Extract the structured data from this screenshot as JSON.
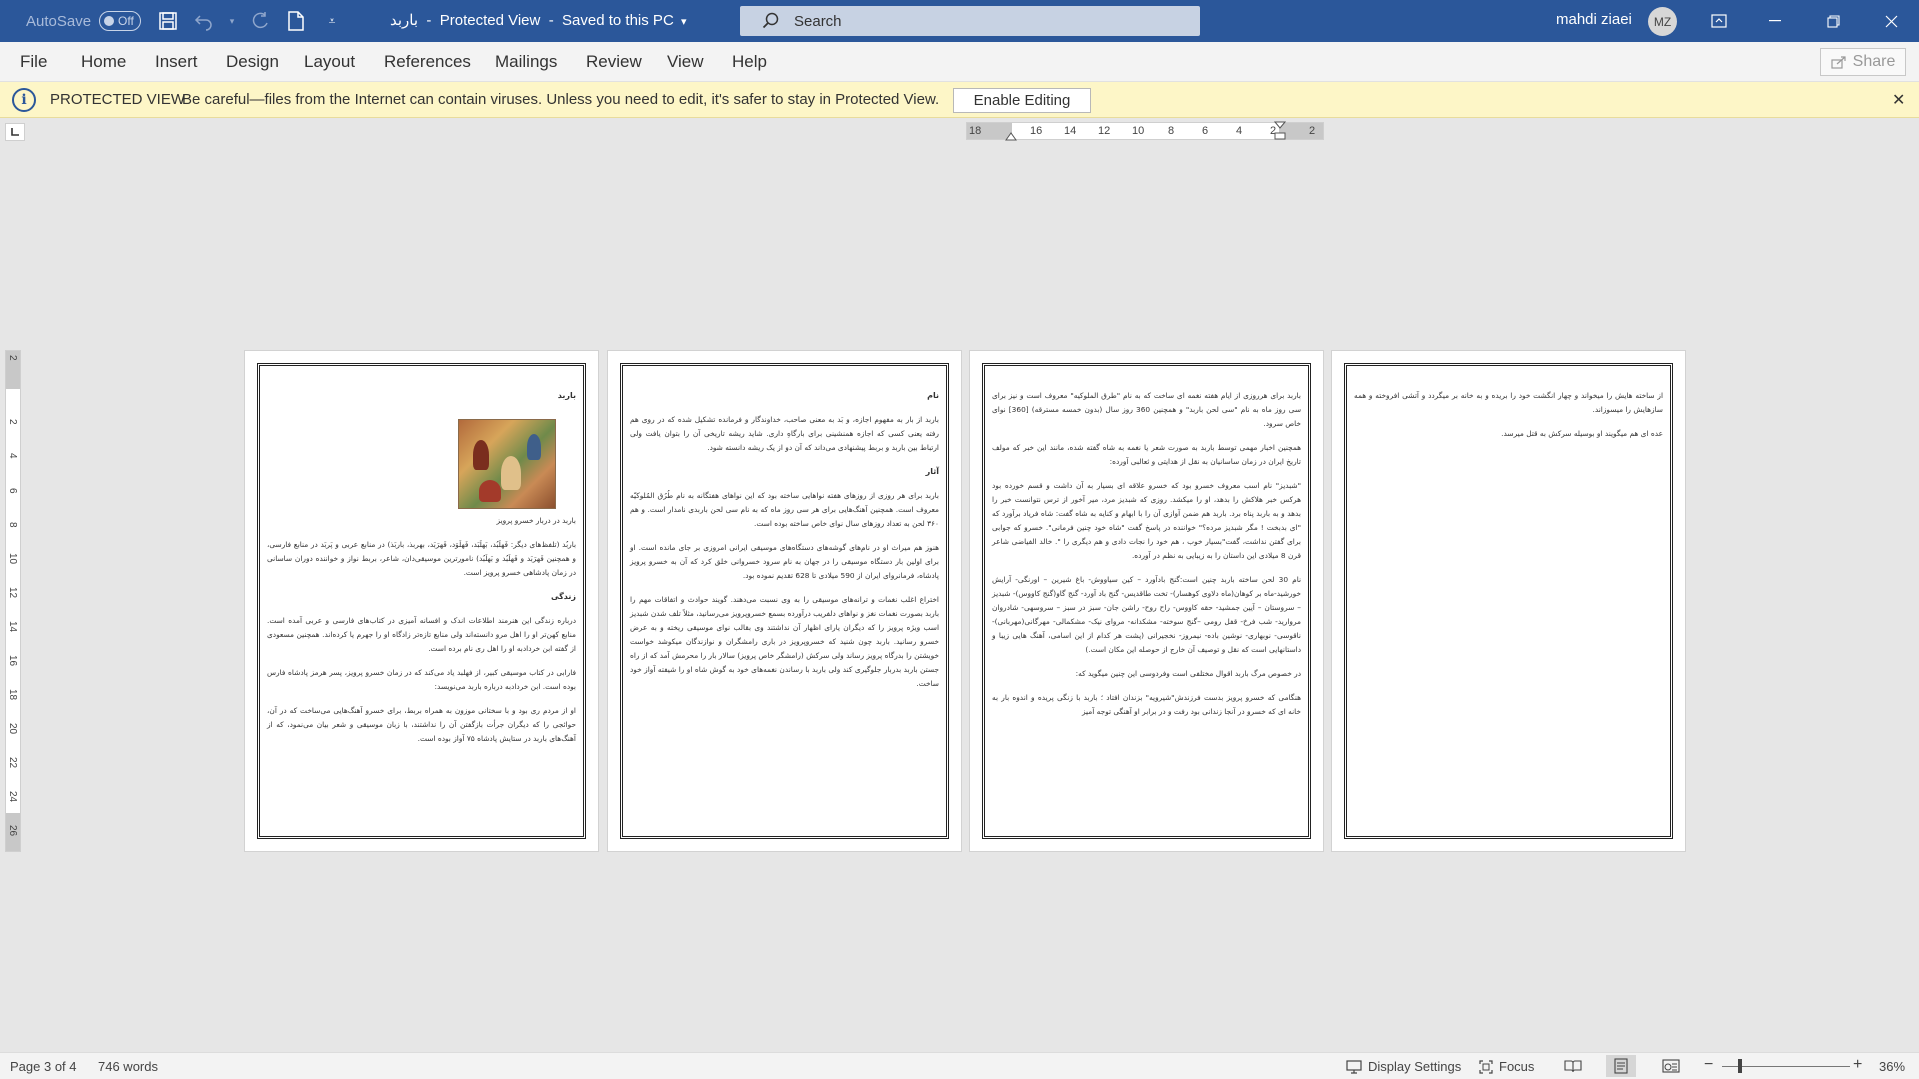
{
  "titlebar": {
    "autosave_label": "AutoSave",
    "autosave_state": "Off",
    "doc_name": "باربد",
    "separator1": "-",
    "view_mode": "Protected View",
    "separator2": "-",
    "save_status": "Saved to this PC",
    "search_placeholder": "Search",
    "user_name": "mahdi ziaei",
    "user_initials": "MZ",
    "accent_color": "#2b579a"
  },
  "menu": {
    "items": [
      "File",
      "Home",
      "Insert",
      "Design",
      "Layout",
      "References",
      "Mailings",
      "Review",
      "View",
      "Help"
    ],
    "share_label": "Share"
  },
  "protected": {
    "label": "PROTECTED VIEW",
    "message": "Be careful—files from the Internet can contain viruses. Unless you need to edit, it's safer to stay in Protected View.",
    "enable_label": "Enable Editing",
    "bar_color": "#fdf6c7"
  },
  "ruler": {
    "horizontal": [
      "18",
      "16",
      "14",
      "12",
      "10",
      "8",
      "6",
      "4",
      "2",
      "2"
    ],
    "vertical": [
      "2",
      "2",
      "4",
      "6",
      "8",
      "10",
      "12",
      "14",
      "16",
      "18",
      "20",
      "22",
      "24",
      "26"
    ]
  },
  "pages": {
    "p1": {
      "title": "باربد",
      "caption": "باربد در دربار خسرو پرویز",
      "para1": "باربُد (تلفظ‌های دیگر: فَهلَبُد، بَهلَبَد، فَهلَوَد، فَهرَبَد، بهربذ، باربَذ) در منابع عربی و پَربَد در منابع فارسی، و همچنین فَهرَبَد و فَهلَبُد و بَهلَبُد) نامورترین موسیقی‌دان، شاعر، بربط نواز و خواننده دوران ساسانی در زمان پادشاهی خسرو پرویز است.",
      "head2": "زندگی",
      "para2": "درباره زندگی این هنرمند اطلاعات اندک و افسانه آمیزی در کتاب‌های فارسی و عربی آمده است. منابع کهن‌تر او را اهل مرو دانسته‌اند ولی منابع تازه‌تر زادگاه او را جهرم یا کرد‌ه‌اند. همچنین مسعودی از گفته ابن خردادبه او را اهل ری نام برده است.",
      "para3": "فارابی در کتاب موسیقی کبیر، از فهلبد یاد می‌کند که در زمان خسرو پرویز، پسر هرمز پادشاه فارس بوده است. ابن خردادبه درباره باربد می‌نویسد:",
      "para4": "او از مردم ری بود و با سختانی موزون به همراه بربط، برای خسرو آهنگ‌هایی می‌ساخت که در آن، حوائجی را که دیگران جرأت بازگفتن آن را نداشتند، با زبان موسیقی و شعر بیان می‌نمود، که از آهنگ‌های باربد در ستایش پادشاه ۷۵ آواز بوده است."
    },
    "p2": {
      "head1": "نام",
      "para1": "باربد از بار به مفهوم اجازه، و بَد به معنی صاحب، خداوندگار و فرمانده تشکیل شده که در روی هم رفته یعنی کسی که اجازه همنشینی برای بارگاهِ داری. شاید ریشه تاریخی آن را بتوان یافت ولی ارتباط بین باربد و بربط پیشنهادی می‌داند که آن دو از یک ریشه دانسته شود.",
      "head2": "آثار",
      "para2": "باربد برای هر روزی از روزهای هفته نواهایی ساخته بود که این نواهای هفتگانه به نام طُرُق المُلوکیّه معروف است. همچنین آهنگ‌هایی برای هر سی روز ماه که به نام سی لحن باربدی نامدار است. و هم ۳۶۰ لحن به تعداد روزهای سال نوای خاص ساخته بوده است.",
      "para3": "هنوز هم میراث او در نام‌های گوشه‌های دستگاه‌های موسیقی ایرانی امروزی بر جای مانده است. او برای اولین بار دستگاه موسیقی را در جهان به نام سرود خسروانی خلق کرد که آن به خسرو پرویز پادشاه، فرمانروای ایران از 590 میلادی تا 628 تقدیم نموده بود.",
      "para4": "اختراع اغلب نغمات و ترانه‌های موسیقی را به وی نسبت می‌دهند. گویند حوادث و اتفاقات مهم را باربد بصورت نغمات نغز و نواهای دلفریب درآورده بسمع خسروپرویز می‌رسانید، مثلاً تلف شدن شبدیز اسب ویژه پرویز را که دیگران یارای اظهار آن نداشتند وی بقالب نوای موسیقی ریخته و به عرض خسرو رسانید. باربد چون شنید که خسروپرویز در باری رامشگران و نوازندگان میکوشد خواست خویشتن را بدرگاه پرویز رساند ولی سرکش (رامشگر خاص پرویز) سالار بار را محرمش آمد که از راه جستن باربد بدربار جلوگیری کند ولی باربد با رساندن نغمه‌های خود به گوش شاه او را شیفته آواز خود ساخت."
    },
    "p3": {
      "para1": "باربد برای هرروزی از ایام هفته نغمه ای ساخت که به نام \"طرق الملوکیه\" معروف است و نیز برای سی روز ماه به نام \"سی لحن باربد\" و همچنین 360 روز سال (بدون خمسه مسترقه) [360] نوای خاص سرود.",
      "para2": "همچنین اخبار مهمی توسط باربد به صورت شعر یا نغمه به شاه گفته شده، مانند این خبر که مولف تاریخ ایران در زمان ساسانیان به نقل از هدایتی و ثعالبی آورده:",
      "para3": "\"شبدیز\" نام اسب معروف خسرو بود که خسرو علاقه ای بسیار به آن داشت و قسم خورده بود هرکس خبر هلاکش را بدهد، او را میکشد. روزی که شبدیز مرد، میر آخور از ترس نتوانست خبر را بدهد و به باربد پناه برد. باربد هم ضمن آوازی آن را با ابهام و کنایه به شاه گفت: شاه فریاد برآورد که \"ای بدبخت ! مگر شبدیز مرده؟\" خواننده در پاسخ گفت \"شاه خود چنین فرمانی\". خسرو که جوابی برای گفتن نداشت، گفت\"بسیار خوب ، هم خود را نجات دادی و هم دیگری را \". خالد الفیاضی شاعر قرن 8 میلادی این داستان را به زیبایی به نظم در آورده.",
      "para4": "نام 30 لحن ساخته باربد چنین است:گنج بادآورد – کین سیاووش- باغ شیرین – اورنگی- آرایش خورشید-ماه بر کوهان(ماه دلاوی کوهسار)- تخت طاقدیس- گنج باد آورد- گنج گاو(گنج کاووس)- شبدیز – سروستان – آیین جمشید- حقه کاووس- راح روح- راشن جان- سبز در سبز – سروسهی- شادروان مروارید- شب فرخ- قفل رومی –گنج سوخته- مشکدانه- مروای نیک- مشکمالی- مهرگانی(مهربانی)- ناقوسی- نوبهاری- نوشین باده- نیمروز- نخجیرانی (پشت هر کدام از این اسامی، آهنگ هایی زیبا و داستانهایی است که نقل و توصیف آن خارج از حوصله این مکان است.)",
      "para5": "در خصوص مرگ باربد اقوال مختلفی است وفردوسی این چنین میگوید که:",
      "para6": "هنگامی که خسرو پرویز بدست فرزندش\"شیرویه\" بزندان افتاد ؛ باربد با زنگی پریده و اندوه بار به خانه ای که خسرو در آنجا زندانی بود رفت و در برابر او آهنگی توجه آمیز"
    },
    "p4": {
      "para1": "از ساخته هایش را میخواند و چهار انگشت خود را بریده و به خانه بر میگردد و آتشی افروخته و همه سازهایش را میسوزاند.",
      "para2": "عده ای هم میگویند او بوسیله سرکش به قتل میرسد."
    }
  },
  "status": {
    "page_label": "Page 3 of 4",
    "words_label": "746 words",
    "display_settings": "Display Settings",
    "focus": "Focus",
    "zoom": "36%"
  }
}
